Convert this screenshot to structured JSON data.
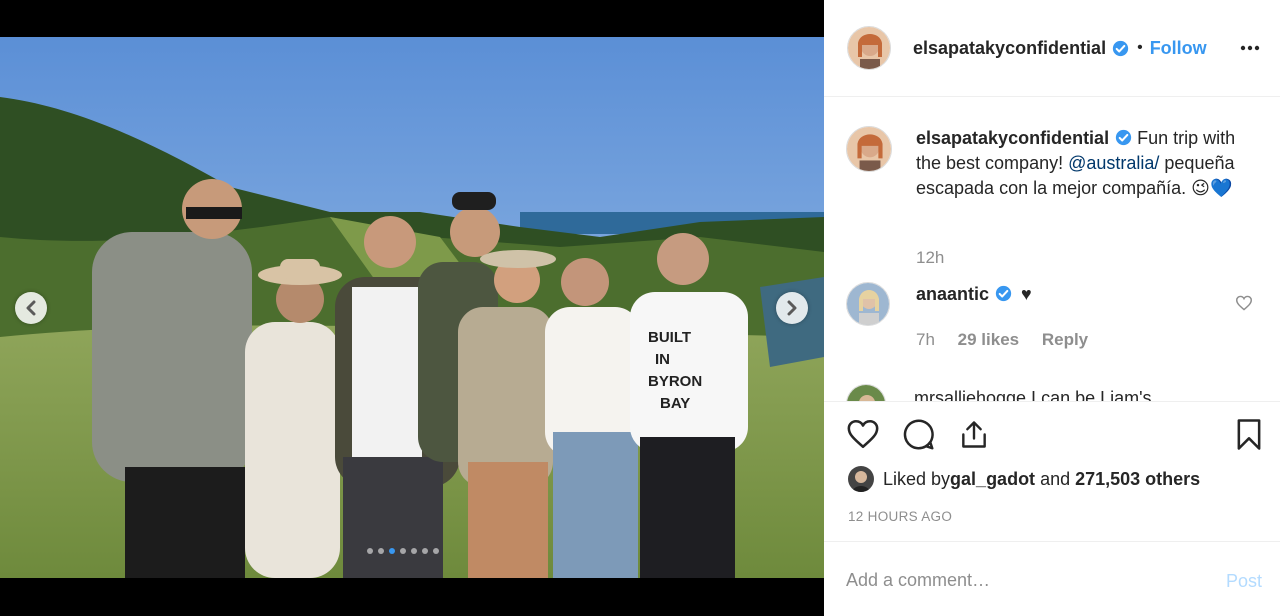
{
  "header": {
    "username": "elsapatakyconfidential",
    "separator": "•",
    "follow_label": "Follow"
  },
  "caption": {
    "username": "elsapatakyconfidential",
    "text_part1": "Fun trip with the best company! ",
    "mention": "@australia/",
    "text_part2": " pequeña escapada con la mejor compañía. ",
    "emojis": [
      "😉",
      "💙"
    ],
    "time": "12h"
  },
  "comment": {
    "username": "anaantic",
    "text": "♥",
    "time": "7h",
    "likes": "29 likes",
    "reply_label": "Reply"
  },
  "next_comment_partial": {
    "text": "mrsalliehogge I can be Liam's"
  },
  "likes_line": {
    "prefix": "Liked by ",
    "user": "gal_gadot",
    "middle": " and ",
    "count": "271,503 others"
  },
  "timestamp": "12 HOURS AGO",
  "add_comment": {
    "placeholder": "Add a comment…",
    "post_label": "Post"
  },
  "carousel": {
    "dot_count": 7,
    "active_index": 2
  },
  "colors": {
    "accent": "#3897f0",
    "text": "#262626",
    "muted": "#8e8e8e",
    "post_disabled": "#b3dbff"
  }
}
